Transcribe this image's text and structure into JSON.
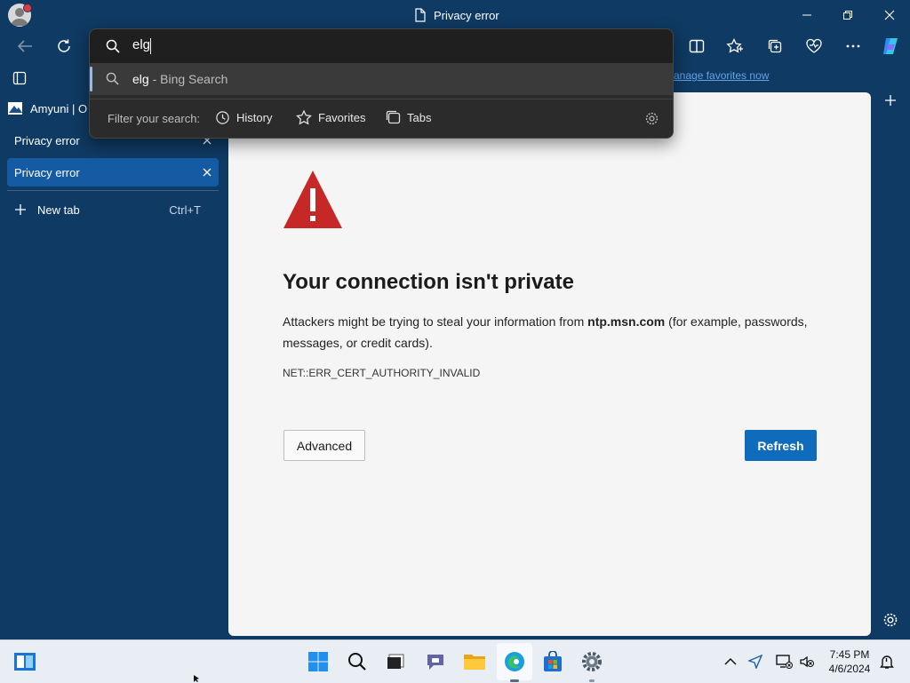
{
  "window": {
    "title": "Privacy error"
  },
  "address_bar": {
    "query": "elg",
    "suggestion": {
      "query": "elg",
      "separator": " - ",
      "engine": "Bing Search"
    },
    "filter_label": "Filter your search:",
    "filters": [
      "History",
      "Favorites",
      "Tabs"
    ]
  },
  "favorites_bar": {
    "link_text": "anage favorites now"
  },
  "sidebar": {
    "pinned_label": "Amyuni | O",
    "tabs": [
      {
        "label": "Privacy error"
      },
      {
        "label": "Privacy error"
      }
    ],
    "new_tab_label": "New tab",
    "new_tab_shortcut": "Ctrl+T"
  },
  "page": {
    "heading": "Your connection isn't private",
    "message_prefix": "Attackers might be trying to steal your information from ",
    "message_domain": "ntp.msn.com",
    "message_suffix": " (for example, passwords, messages, or credit cards).",
    "error_code": "NET::ERR_CERT_AUTHORITY_INVALID",
    "advanced_label": "Advanced",
    "refresh_label": "Refresh"
  },
  "taskbar": {
    "time": "7:45 PM",
    "date": "4/6/2024"
  },
  "colors": {
    "window_bg": "#0f3a63",
    "active_tab": "#155ba3",
    "warning_red": "#c62828",
    "refresh_blue": "#0f6cbd",
    "link_blue": "#62a3e6"
  },
  "icons": [
    "profile-avatar",
    "page-icon",
    "minimize-icon",
    "restore-icon",
    "close-icon",
    "back-icon",
    "refresh-icon",
    "search-icon",
    "split-screen-icon",
    "favorites-icon",
    "collections-icon",
    "browser-essentials-icon",
    "more-icon",
    "copilot-icon",
    "vertical-tabs-icon",
    "history-icon",
    "star-icon",
    "tabs-icon",
    "settings-icon",
    "warning-icon",
    "windows-start-icon",
    "task-view-icon",
    "teams-icon",
    "file-explorer-icon",
    "edge-icon",
    "store-icon",
    "chevron-up-icon",
    "location-icon",
    "network-icon",
    "volume-muted-icon",
    "notifications-icon"
  ]
}
